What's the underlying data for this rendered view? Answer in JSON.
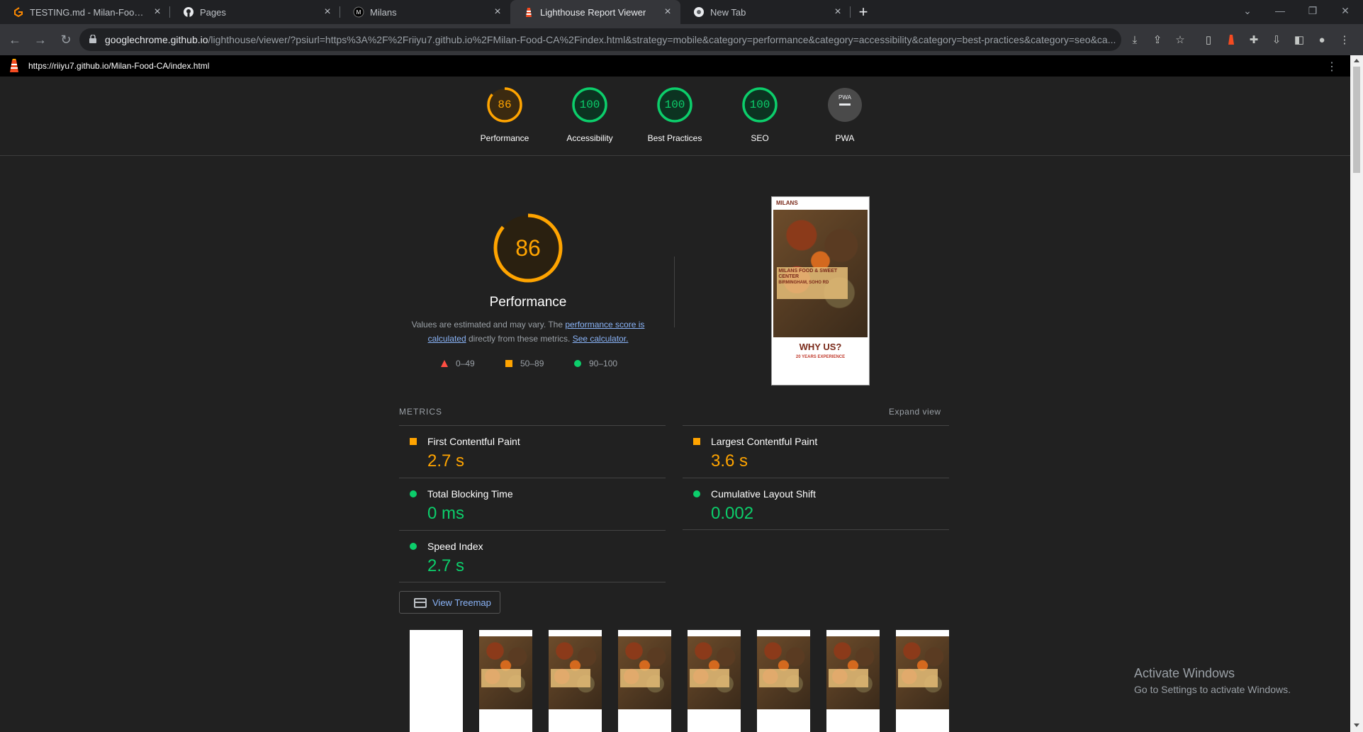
{
  "browser": {
    "tabs": [
      {
        "label": "TESTING.md - Milan-Food-CA -",
        "icon": "gitpod-icon",
        "active": false
      },
      {
        "label": "Pages",
        "icon": "github-icon",
        "active": false
      },
      {
        "label": "Milans",
        "icon": "milans-icon",
        "active": false
      },
      {
        "label": "Lighthouse Report Viewer",
        "icon": "lighthouse-icon",
        "active": true
      },
      {
        "label": "New Tab",
        "icon": "chrome-icon",
        "active": false
      }
    ],
    "url_host": "googlechrome.github.io",
    "url_path": "/lighthouse/viewer/?psiurl=https%3A%2F%2Friiyu7.github.io%2FMilan-Food-CA%2Findex.html&strategy=mobile&category=performance&category=accessibility&category=best-practices&category=seo&ca..."
  },
  "report": {
    "url": "https://riiyu7.github.io/Milan-Food-CA/index.html",
    "categories": [
      {
        "score": "86",
        "label": "Performance",
        "status": "average"
      },
      {
        "score": "100",
        "label": "Accessibility",
        "status": "pass"
      },
      {
        "score": "100",
        "label": "Best Practices",
        "status": "pass"
      },
      {
        "score": "100",
        "label": "SEO",
        "status": "pass"
      },
      {
        "score": "PWA",
        "label": "PWA",
        "status": "na"
      }
    ],
    "performance": {
      "score": "86",
      "title": "Performance",
      "desc_pre": "Values are estimated and may vary. The ",
      "desc_link1": "performance score is calculated",
      "desc_mid": " directly from these metrics. ",
      "desc_link2": "See calculator."
    },
    "legend": [
      {
        "range": "0–49",
        "shape": "triangle",
        "color": "#ff4e42"
      },
      {
        "range": "50–89",
        "shape": "square",
        "color": "#ffa400"
      },
      {
        "range": "90–100",
        "shape": "circle",
        "color": "#0cce6b"
      }
    ],
    "metrics_title": "METRICS",
    "expand_label": "Expand view",
    "metrics": [
      {
        "name": "First Contentful Paint",
        "value": "2.7 s",
        "status": "average"
      },
      {
        "name": "Largest Contentful Paint",
        "value": "3.6 s",
        "status": "average"
      },
      {
        "name": "Total Blocking Time",
        "value": "0 ms",
        "status": "pass"
      },
      {
        "name": "Cumulative Layout Shift",
        "value": "0.002",
        "status": "pass"
      },
      {
        "name": "Speed Index",
        "value": "2.7 s",
        "status": "pass"
      }
    ],
    "treemap_label": "View Treemap",
    "thumbnail": {
      "brand": "MILANS",
      "hero": "MILANS FOOD & SWEET CENTER",
      "hero_sub": "BIRMINGHAM, SOHO RD",
      "why": "WHY US?",
      "years": "20 YEARS EXPERIENCE"
    }
  },
  "colors": {
    "average": "#ffa400",
    "pass": "#0cce6b",
    "fail": "#ff4e42"
  },
  "watermark": {
    "title": "Activate Windows",
    "sub": "Go to Settings to activate Windows."
  }
}
